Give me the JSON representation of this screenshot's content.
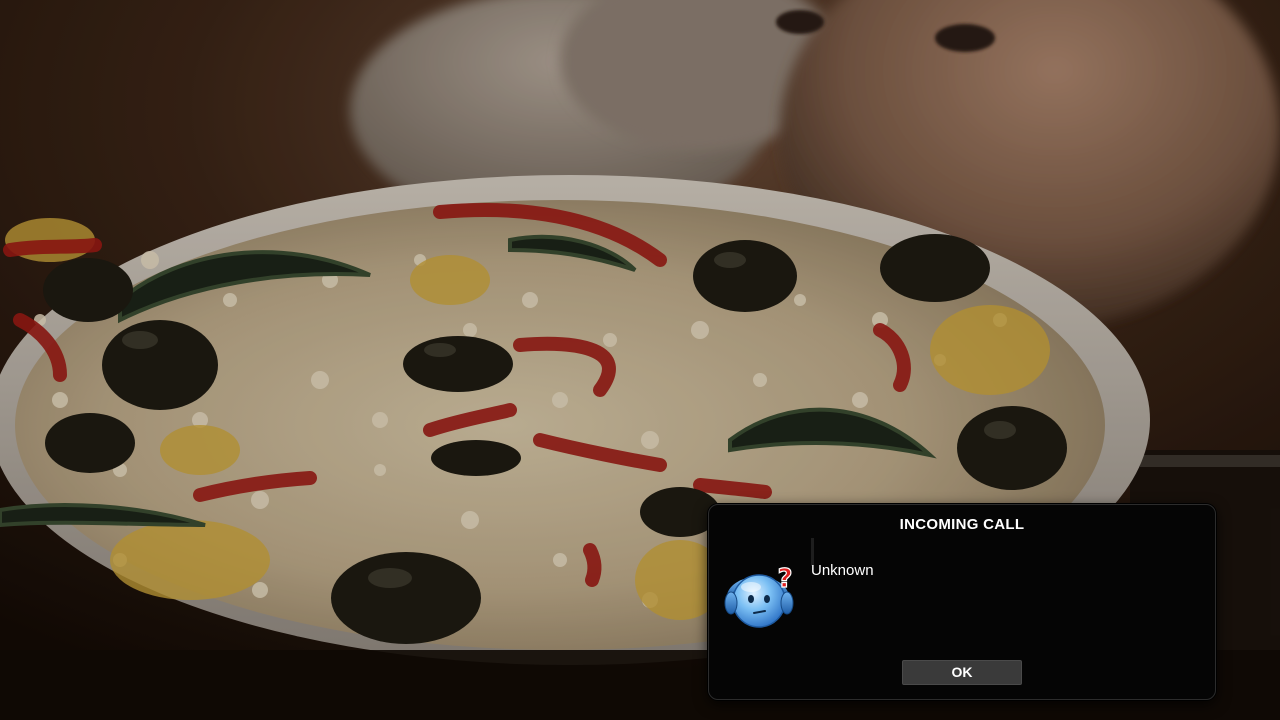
{
  "dialog": {
    "title": "INCOMING CALL",
    "caller_name": "Unknown",
    "ok_label": "OK",
    "avatar_icon": "unknown-caller-icon"
  },
  "colors": {
    "dialog_background": "#050505",
    "button_background": "#3a3a3a",
    "text": "#ffffff",
    "avatar_blue": "#4a9ee8",
    "question_mark_red": "#e02020"
  }
}
